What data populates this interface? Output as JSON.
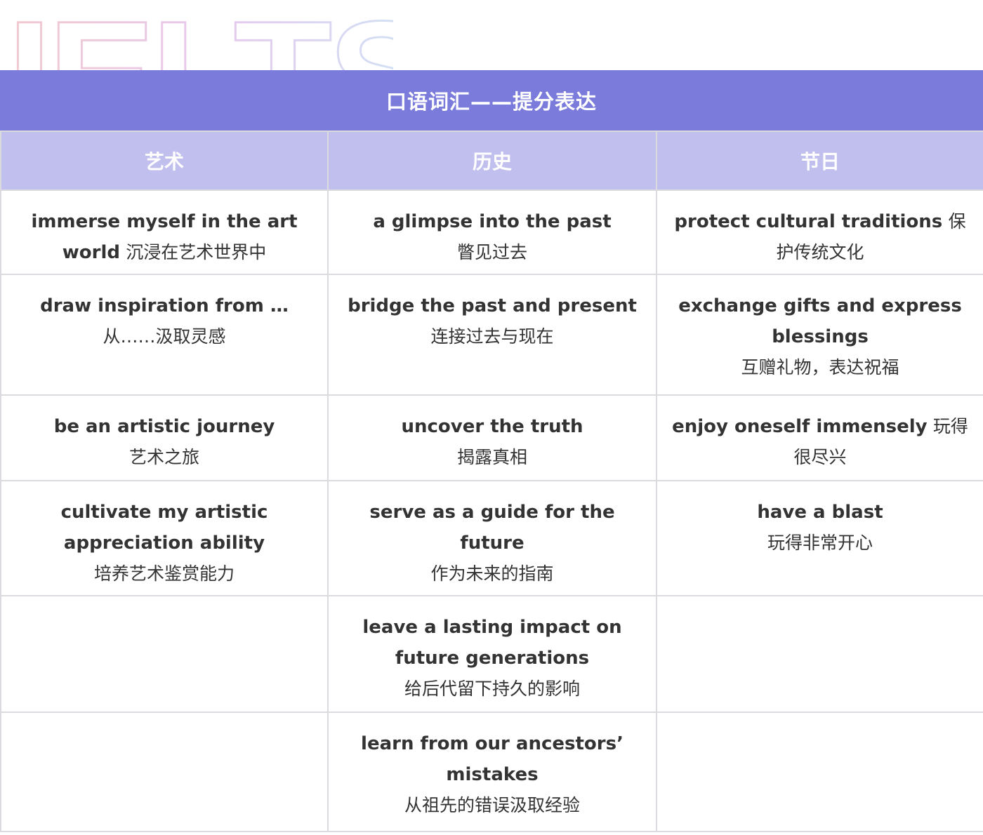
{
  "watermark": {
    "text": "IELTS"
  },
  "title": "口语词汇——提分表达",
  "columns": [
    "艺术",
    "历史",
    "节日"
  ],
  "rows": [
    [
      {
        "en": "immerse myself in the art world",
        "zh": "沉浸在艺术世界中",
        "inline": true
      },
      {
        "en": "a glimpse into the past",
        "zh": "瞥见过去",
        "inline": false
      },
      {
        "en": "protect cultural traditions",
        "zh": "保护传统文化",
        "inline": true
      }
    ],
    [
      {
        "en": "draw inspiration from …",
        "zh": "从……汲取灵感",
        "inline": false
      },
      {
        "en": "bridge the past and present",
        "zh": "连接过去与现在",
        "inline": false
      },
      {
        "en": "exchange gifts and express blessings",
        "zh": "互赠礼物，表达祝福",
        "inline": false
      }
    ],
    [
      {
        "en": "be an artistic journey",
        "zh": "艺术之旅",
        "inline": false
      },
      {
        "en": "uncover the truth",
        "zh": "揭露真相",
        "inline": false
      },
      {
        "en": "enjoy oneself immensely",
        "zh": "玩得很尽兴",
        "inline": true
      }
    ],
    [
      {
        "en": "cultivate my artistic appreciation ability",
        "zh": "培养艺术鉴赏能力",
        "inline": false
      },
      {
        "en": "serve as a guide for the future",
        "zh": "作为未来的指南",
        "inline": false
      },
      {
        "en": "have a blast",
        "zh": "玩得非常开心",
        "inline": false
      }
    ],
    [
      {
        "en": "",
        "zh": "",
        "inline": false
      },
      {
        "en": "leave a lasting impact on future generations",
        "zh": "给后代留下持久的影响",
        "inline": false
      },
      {
        "en": "",
        "zh": "",
        "inline": false
      }
    ],
    [
      {
        "en": "",
        "zh": "",
        "inline": false
      },
      {
        "en": "learn from our ancestors’ mistakes",
        "zh": "从祖先的错误汲取经验",
        "inline": false
      },
      {
        "en": "",
        "zh": "",
        "inline": false
      }
    ]
  ],
  "colors": {
    "title_bg": "#7a7bdb",
    "header_bg": "#c0bfee",
    "border": "#dadadf",
    "text": "#333333"
  }
}
